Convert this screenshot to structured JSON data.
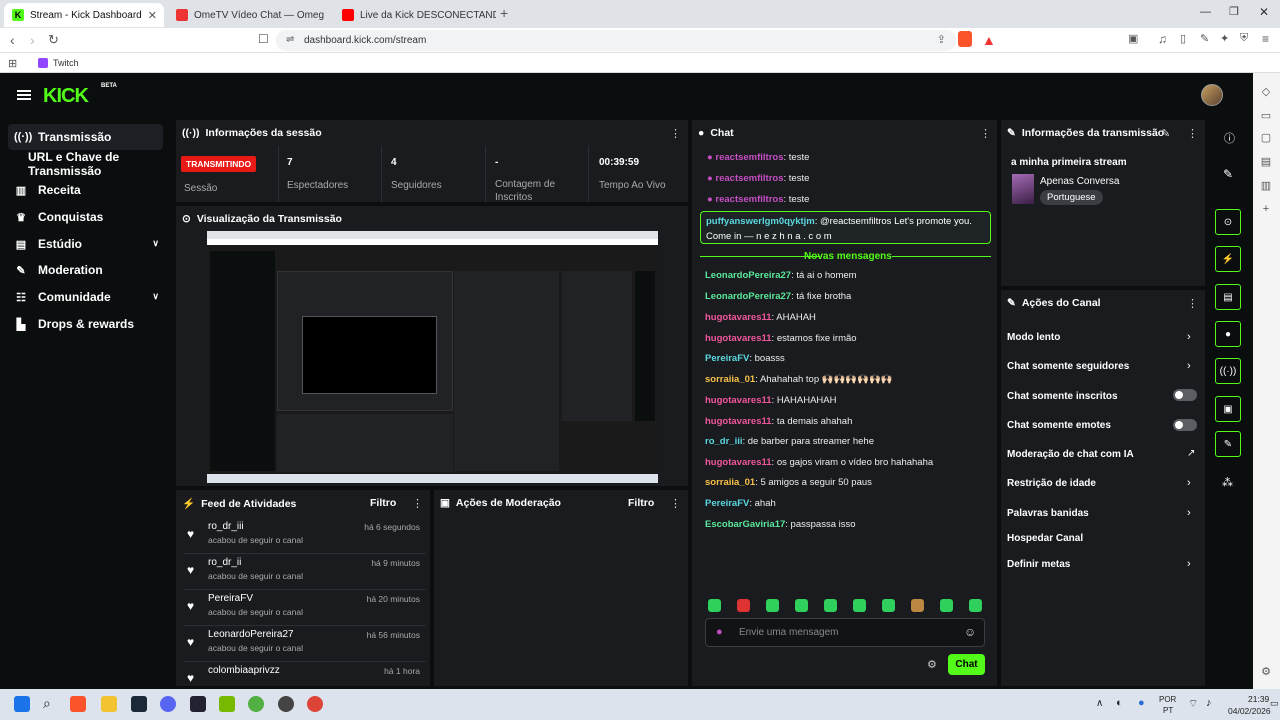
{
  "browser": {
    "tabs": [
      {
        "title": "Stream - Kick Dashboard"
      },
      {
        "title": "OmeTV Vídeo Chat — Omeg"
      },
      {
        "title": "Live da Kick DESCONECTANDO ou TE"
      }
    ],
    "url": "dashboard.kick.com/stream",
    "bookmark": "Twitch",
    "colors": {
      "accent": "#53fc18"
    }
  },
  "app": {
    "logo": "KICK",
    "beta": "BETA",
    "sidebar": [
      {
        "label": "Transmissão",
        "icon": "broadcast-icon"
      },
      {
        "label": "URL e Chave de Transmissão",
        "icon": ""
      },
      {
        "label": "Receita",
        "icon": "revenue-icon"
      },
      {
        "label": "Conquistas",
        "icon": "trophy-icon"
      },
      {
        "label": "Estúdio",
        "icon": "studio-icon"
      },
      {
        "label": "Moderation",
        "icon": "wrench-icon"
      },
      {
        "label": "Comunidade",
        "icon": "community-icon"
      },
      {
        "label": "Drops & rewards",
        "icon": "drops-icon"
      }
    ],
    "session": {
      "title": "Informações da sessão",
      "live_badge": "TRANSMITINDO",
      "status_label": "Sessão",
      "viewers": "7",
      "viewers_label": "Espectadores",
      "followers": "4",
      "followers_label": "Seguidores",
      "subs": "-",
      "subs_label": "Contagem de Inscritos",
      "time": "00:39:59",
      "time_label": "Tempo Ao Vivo"
    },
    "preview": {
      "title": "Visualização da Transmissão"
    },
    "feed": {
      "title": "Feed de Atividades",
      "filter": "Filtro",
      "items": [
        {
          "name": "ro_dr_iii",
          "sub": "acabou de seguir o canal",
          "time": "há 6 segundos"
        },
        {
          "name": "ro_dr_ii",
          "sub": "acabou de seguir o canal",
          "time": "há 9 minutos"
        },
        {
          "name": "PereiraFV",
          "sub": "acabou de seguir o canal",
          "time": "há 20 minutos"
        },
        {
          "name": "LeonardoPereira27",
          "sub": "acabou de seguir o canal",
          "time": "há 56 minutos"
        },
        {
          "name": "colombiaaprivzz",
          "sub": "",
          "time": "há 1 hora"
        }
      ]
    },
    "mod": {
      "title": "Ações de Moderação",
      "filter": "Filtro"
    },
    "chat": {
      "title": "Chat",
      "new_messages": "Novas mensagens",
      "pinned_user": "puffyanswerlgm0qyktjm",
      "pinned_text": ": @reactsemfiltros Let's promote you.",
      "pinned_text2": "Come in — n e z h n a . c o m",
      "messages": [
        {
          "user": "reactsemfiltros",
          "text": ": teste",
          "cls": "m"
        },
        {
          "user": "reactsemfiltros",
          "text": ": teste",
          "cls": "m"
        },
        {
          "user": "reactsemfiltros",
          "text": ": teste",
          "cls": "m"
        },
        {
          "user": "LeonardoPereira27",
          "text": ": tá ai o homem",
          "cls": "g"
        },
        {
          "user": "LeonardoPereira27",
          "text": ": tá fixe brotha",
          "cls": "g"
        },
        {
          "user": "hugotavares11",
          "text": ": AHAHAH",
          "cls": "p"
        },
        {
          "user": "hugotavares11",
          "text": ": estamos fixe irmão",
          "cls": "p"
        },
        {
          "user": "PereiraFV",
          "text": ": boasss",
          "cls": "c"
        },
        {
          "user": "sorraiia_01",
          "text": ": Ahahahah top 🙌🏻🙌🏻🙌🏻🙌🏻🙌🏻🙌🏻",
          "cls": "y"
        },
        {
          "user": "hugotavares11",
          "text": ": HAHAHAHAH",
          "cls": "p"
        },
        {
          "user": "hugotavares11",
          "text": ": ta demais ahahah",
          "cls": "p"
        },
        {
          "user": "ro_dr_iii",
          "text": ": de barber para streamer hehe",
          "cls": "c"
        },
        {
          "user": "hugotavares11",
          "text": ": os gajos viram o vídeo bro hahahaha",
          "cls": "p"
        },
        {
          "user": "sorraiia_01",
          "text": ": 5 amigos a seguir 50 paus",
          "cls": "y"
        },
        {
          "user": "PereiraFV",
          "text": ": ahah",
          "cls": "c"
        },
        {
          "user": "EscobarGaviria17",
          "text": ": passpassa isso",
          "cls": "g"
        }
      ],
      "input_placeholder": "Envie uma mensagem",
      "send": "Chat"
    },
    "stream_info": {
      "title": "Informações da transmissão",
      "stream_title": "a minha primeira stream",
      "category": "Apenas Conversa",
      "language": "Portuguese"
    },
    "channel_actions": {
      "title": "Ações do Canal",
      "items": [
        {
          "label": "Modo lento",
          "control": "chevron"
        },
        {
          "label": "Chat somente seguidores",
          "control": "chevron"
        },
        {
          "label": "Chat somente inscritos",
          "control": "toggle"
        },
        {
          "label": "Chat somente emotes",
          "control": "toggle"
        },
        {
          "label": "Moderação de chat com IA",
          "control": "external"
        },
        {
          "label": "Restrição de idade",
          "control": "chevron"
        },
        {
          "label": "Palavras banidas",
          "control": "chevron"
        },
        {
          "label": "Hospedar Canal",
          "control": "none"
        },
        {
          "label": "Definir metas",
          "control": "chevron"
        }
      ]
    }
  },
  "taskbar": {
    "lang1": "POR",
    "lang2": "PT",
    "time": "21:39",
    "date": "04/02/2026"
  }
}
